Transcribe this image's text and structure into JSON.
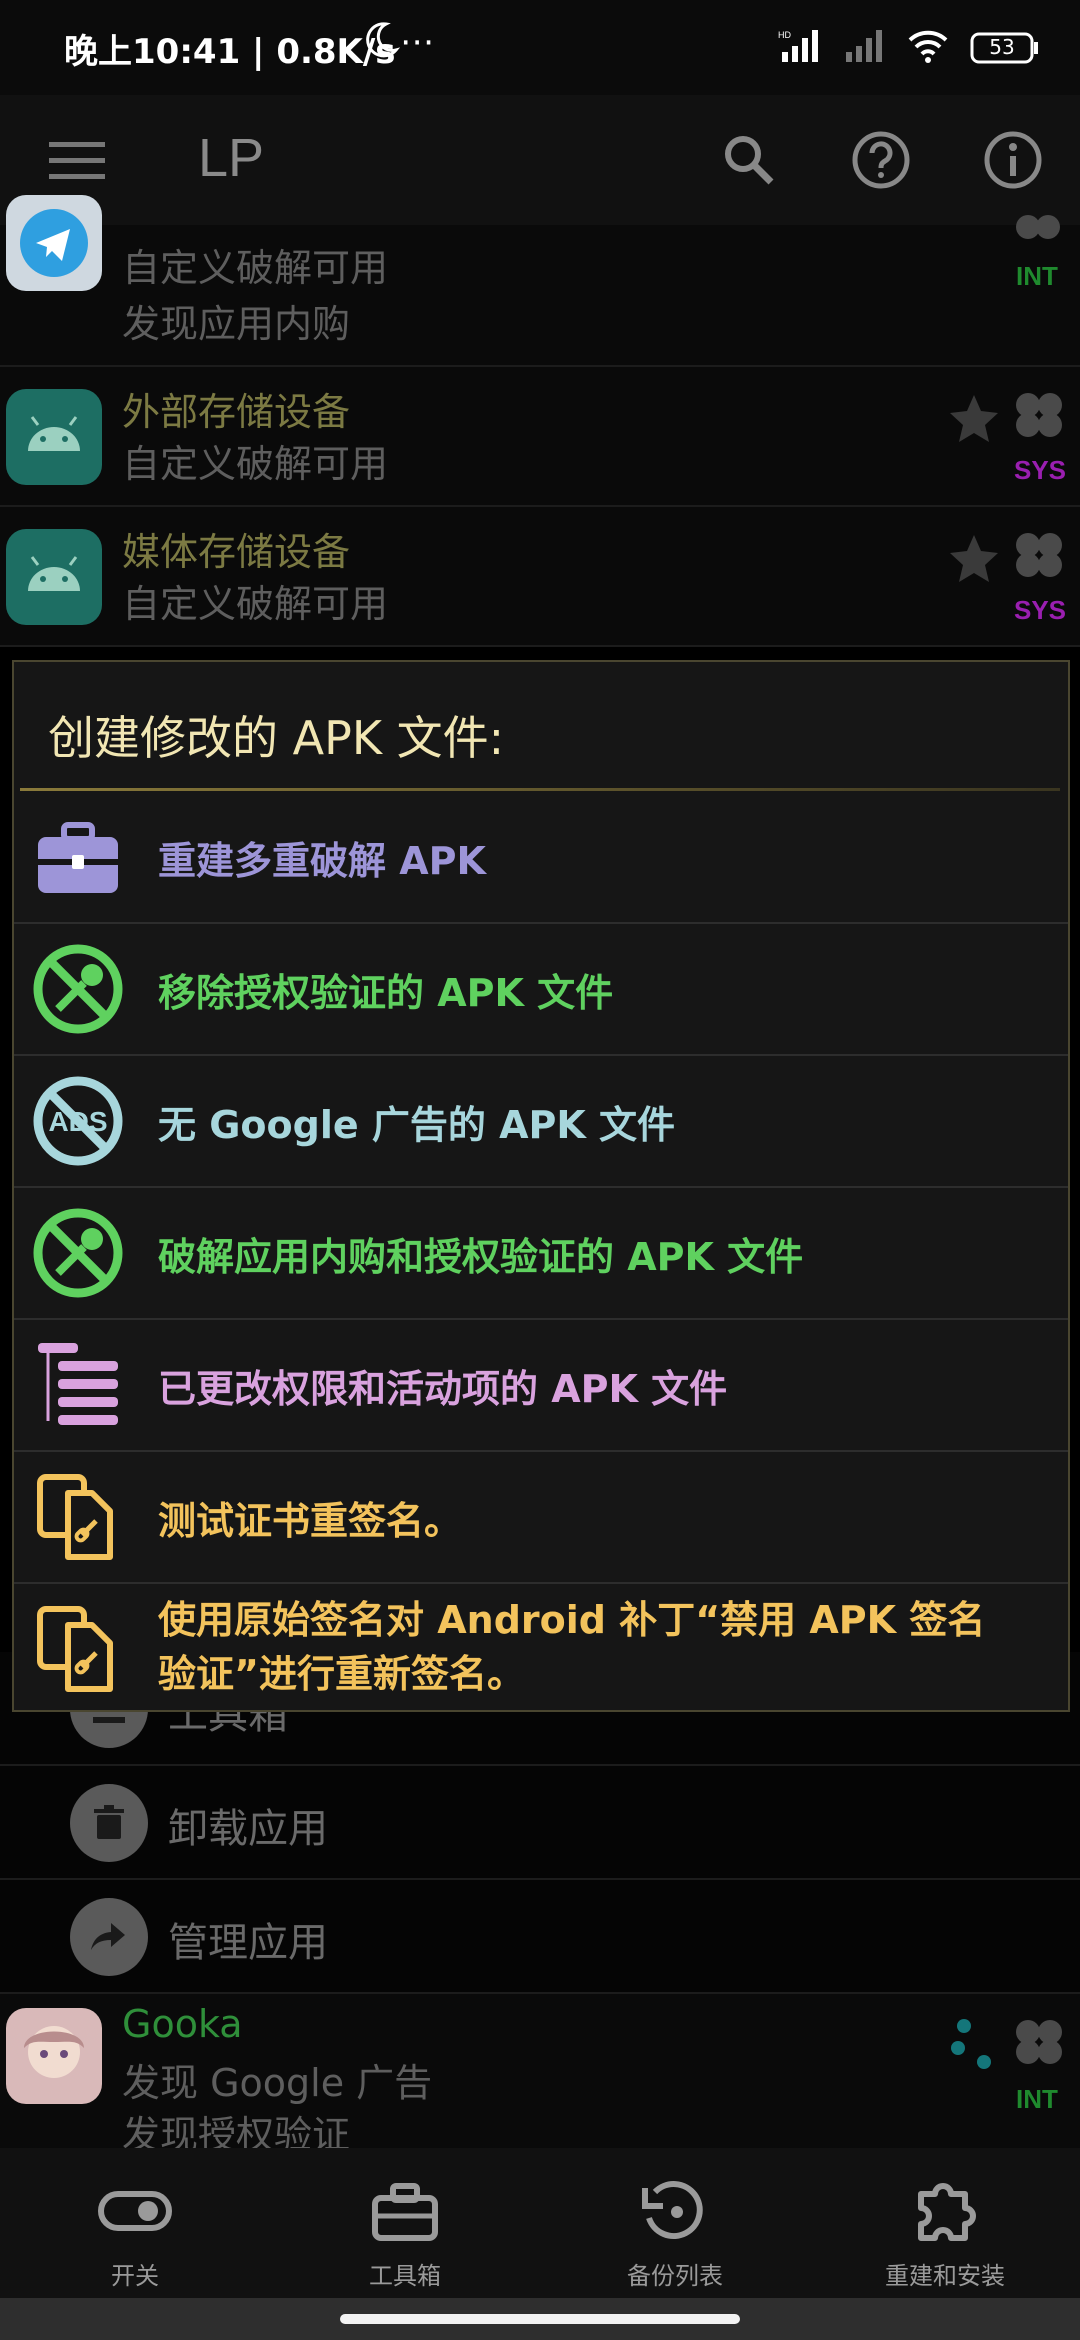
{
  "status_bar": {
    "time": "晚上10:41 | 0.8K/s",
    "battery": "53"
  },
  "app_bar": {
    "title": "LP"
  },
  "list_rows": [
    {
      "line1": "自定义破解可用",
      "line2": "发现应用内购",
      "badge": "INT",
      "badge_color": "#1f8a2e"
    },
    {
      "name": "外部存储设备",
      "line1": "自定义破解可用",
      "badge": "SYS",
      "badge_color": "#9a1fb0"
    },
    {
      "name": "媒体存储设备",
      "line1": "自定义破解可用",
      "badge": "SYS",
      "badge_color": "#9a1fb0"
    }
  ],
  "dialog": {
    "title": "创建修改的 APK 文件:",
    "items": [
      {
        "label": "重建多重破解 APK",
        "icon": "toolbox-icon",
        "color": "#9d95d8"
      },
      {
        "label": "移除授权验证的 APK 文件",
        "icon": "no-key-icon",
        "color": "#5fd15f"
      },
      {
        "label": "无 Google 广告的 APK 文件",
        "icon": "no-ads-icon",
        "color": "#a7d6dc"
      },
      {
        "label": "破解应用内购和授权验证的 APK 文件",
        "icon": "no-key-icon",
        "color": "#5fd15f"
      },
      {
        "label": "已更改权限和活动项的 APK 文件",
        "icon": "permissions-list-icon",
        "color": "#d9a2de"
      },
      {
        "label": "测试证书重签名。",
        "icon": "copy-link-icon",
        "color": "#f3c35c"
      },
      {
        "label": "使用原始签名对 Android 补丁“禁用 APK 签名验证”进行重新签名。",
        "icon": "copy-link-icon",
        "color": "#f3c35c"
      }
    ]
  },
  "menu_rows": [
    {
      "label": "工具箱",
      "icon": "list-icon"
    },
    {
      "label": "卸载应用",
      "icon": "trash-icon"
    },
    {
      "label": "管理应用",
      "icon": "share-arrow-icon"
    }
  ],
  "gooka_row": {
    "name": "Gooka",
    "line1": "发现 Google 广告",
    "line2": "发现授权验证",
    "badge": "INT"
  },
  "bottom_nav": [
    {
      "label": "开关",
      "icon": "toggle-icon"
    },
    {
      "label": "工具箱",
      "icon": "toolbox-icon"
    },
    {
      "label": "备份列表",
      "icon": "backup-icon"
    },
    {
      "label": "重建和安装",
      "icon": "puzzle-icon"
    }
  ]
}
